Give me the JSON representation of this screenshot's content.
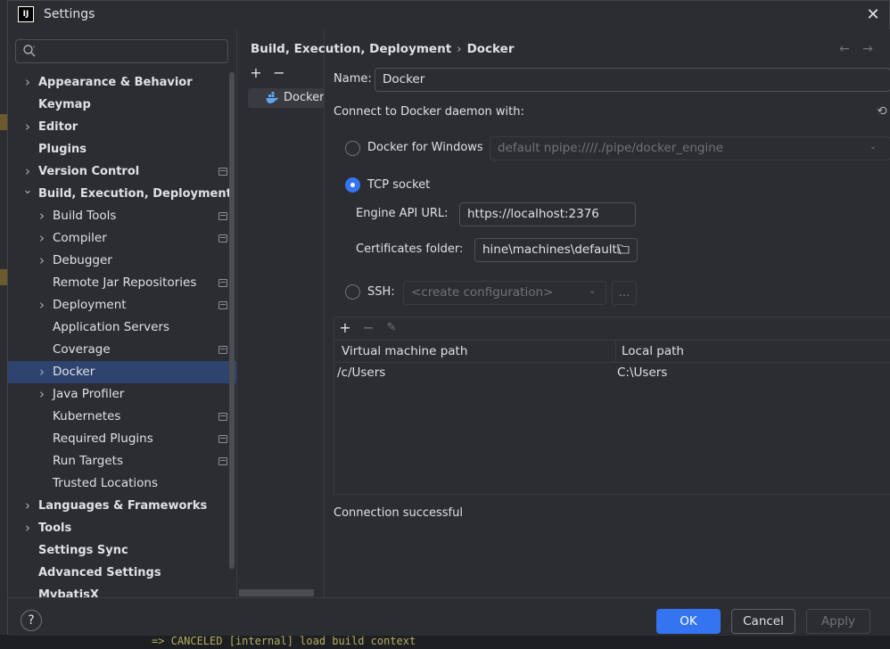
{
  "window": {
    "title": "Settings",
    "logo_text": "IJ"
  },
  "search": {
    "placeholder": "",
    "value": ""
  },
  "tree": {
    "items": [
      {
        "label": "Appearance & Behavior",
        "bold": true,
        "level": 0,
        "expandable": true,
        "expanded": false,
        "project": false
      },
      {
        "label": "Keymap",
        "bold": true,
        "level": 0,
        "expandable": false,
        "project": false
      },
      {
        "label": "Editor",
        "bold": true,
        "level": 0,
        "expandable": true,
        "expanded": false,
        "project": false
      },
      {
        "label": "Plugins",
        "bold": true,
        "level": 0,
        "expandable": false,
        "project": false
      },
      {
        "label": "Version Control",
        "bold": true,
        "level": 0,
        "expandable": true,
        "expanded": false,
        "project": true
      },
      {
        "label": "Build, Execution, Deployment",
        "bold": true,
        "level": 0,
        "expandable": true,
        "expanded": true,
        "project": false
      },
      {
        "label": "Build Tools",
        "bold": false,
        "level": 1,
        "expandable": true,
        "expanded": false,
        "project": true
      },
      {
        "label": "Compiler",
        "bold": false,
        "level": 1,
        "expandable": true,
        "expanded": false,
        "project": true
      },
      {
        "label": "Debugger",
        "bold": false,
        "level": 1,
        "expandable": true,
        "expanded": false,
        "project": false
      },
      {
        "label": "Remote Jar Repositories",
        "bold": false,
        "level": 1,
        "expandable": false,
        "project": true
      },
      {
        "label": "Deployment",
        "bold": false,
        "level": 1,
        "expandable": true,
        "expanded": false,
        "project": true
      },
      {
        "label": "Application Servers",
        "bold": false,
        "level": 1,
        "expandable": false,
        "project": false
      },
      {
        "label": "Coverage",
        "bold": false,
        "level": 1,
        "expandable": false,
        "project": true
      },
      {
        "label": "Docker",
        "bold": false,
        "level": 1,
        "expandable": true,
        "expanded": false,
        "project": false,
        "selected": true
      },
      {
        "label": "Java Profiler",
        "bold": false,
        "level": 1,
        "expandable": true,
        "expanded": false,
        "project": false
      },
      {
        "label": "Kubernetes",
        "bold": false,
        "level": 1,
        "expandable": false,
        "project": true
      },
      {
        "label": "Required Plugins",
        "bold": false,
        "level": 1,
        "expandable": false,
        "project": true
      },
      {
        "label": "Run Targets",
        "bold": false,
        "level": 1,
        "expandable": false,
        "project": true
      },
      {
        "label": "Trusted Locations",
        "bold": false,
        "level": 1,
        "expandable": false,
        "project": false
      },
      {
        "label": "Languages & Frameworks",
        "bold": true,
        "level": 0,
        "expandable": true,
        "expanded": false,
        "project": false
      },
      {
        "label": "Tools",
        "bold": true,
        "level": 0,
        "expandable": true,
        "expanded": false,
        "project": false
      },
      {
        "label": "Settings Sync",
        "bold": true,
        "level": 0,
        "expandable": false,
        "project": false
      },
      {
        "label": "Advanced Settings",
        "bold": true,
        "level": 0,
        "expandable": false,
        "project": false
      },
      {
        "label": "MybatisX",
        "bold": true,
        "level": 0,
        "expandable": false,
        "project": false
      }
    ]
  },
  "middle": {
    "add_symbol": "+",
    "remove_symbol": "−",
    "items": [
      {
        "label": "Docker",
        "icon": "docker-icon"
      }
    ]
  },
  "breadcrumb": {
    "parent": "Build, Execution, Deployment",
    "separator": "›",
    "current": "Docker"
  },
  "nav": {
    "back": "←",
    "forward": "→"
  },
  "form": {
    "name_label": "Name:",
    "name_value": "Docker",
    "connect_label": "Connect to Docker daemon with:",
    "docker_windows_label": "Docker for Windows",
    "docker_windows_value": "default  npipe:////./pipe/docker_engine",
    "tcp_label": "TCP socket",
    "engine_api_label": "Engine API URL:",
    "engine_api_value": "https://localhost:2376",
    "certs_label": "Certificates folder:",
    "certs_value": "hine\\machines\\default\\",
    "ssh_label": "SSH:",
    "ssh_placeholder": "<create configuration>",
    "ssh_more": "...",
    "selected_option": "tcp"
  },
  "mappings": {
    "add_symbol": "+",
    "remove_symbol": "−",
    "edit_symbol": "✎",
    "columns": [
      "Virtual machine path",
      "Local path"
    ],
    "rows": [
      {
        "vm": "/c/Users",
        "local": "C:\\Users"
      }
    ]
  },
  "status": {
    "text": "Connection successful"
  },
  "buttons": {
    "help": "?",
    "ok": "OK",
    "cancel": "Cancel",
    "apply": "Apply"
  },
  "background": {
    "bottom_text": "=> CANCELED [internal] load build context"
  },
  "colors": {
    "accent": "#3574f0",
    "selected_row": "#2e436e",
    "background": "#2b2d30"
  }
}
